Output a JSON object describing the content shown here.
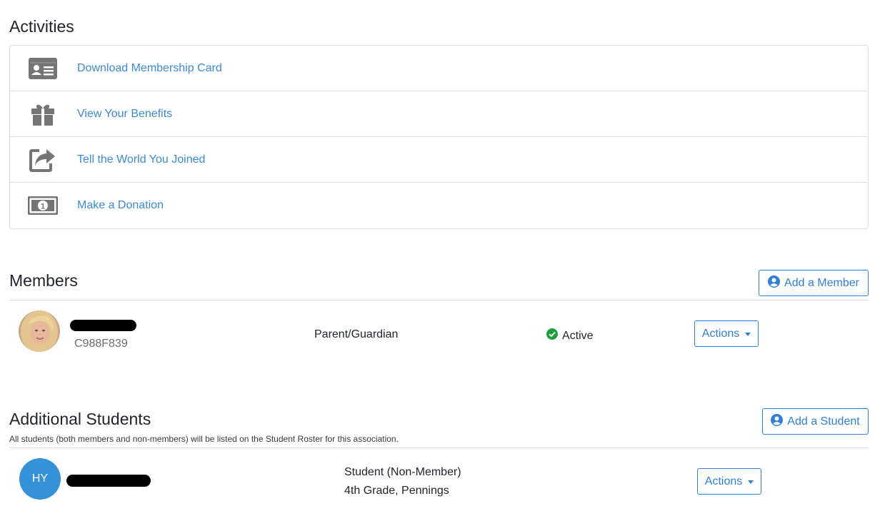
{
  "activities": {
    "title": "Activities",
    "items": [
      {
        "label": "Download Membership Card",
        "icon": "id-card-icon"
      },
      {
        "label": "View Your Benefits",
        "icon": "gift-icon"
      },
      {
        "label": "Tell the World You Joined",
        "icon": "share-icon"
      },
      {
        "label": "Make a Donation",
        "icon": "money-bill-icon"
      }
    ]
  },
  "members": {
    "title": "Members",
    "add_button": "Add a Member",
    "rows": [
      {
        "id": "C988F839",
        "role": "Parent/Guardian",
        "status": "Active",
        "actions_label": "Actions"
      }
    ]
  },
  "students": {
    "title": "Additional Students",
    "subtitle": "All students (both members and non-members) will be listed on the Student Roster for this association.",
    "add_button": "Add a Student",
    "rows": [
      {
        "initials": "HY",
        "type": "Student (Non-Member)",
        "grade": "4th Grade, Pennings",
        "actions_label": "Actions"
      }
    ]
  },
  "colors": {
    "link": "#3b8ad8",
    "accent": "#2f80d6",
    "active": "#1e9e3a",
    "avatar_initials_bg": "#3591d8"
  }
}
